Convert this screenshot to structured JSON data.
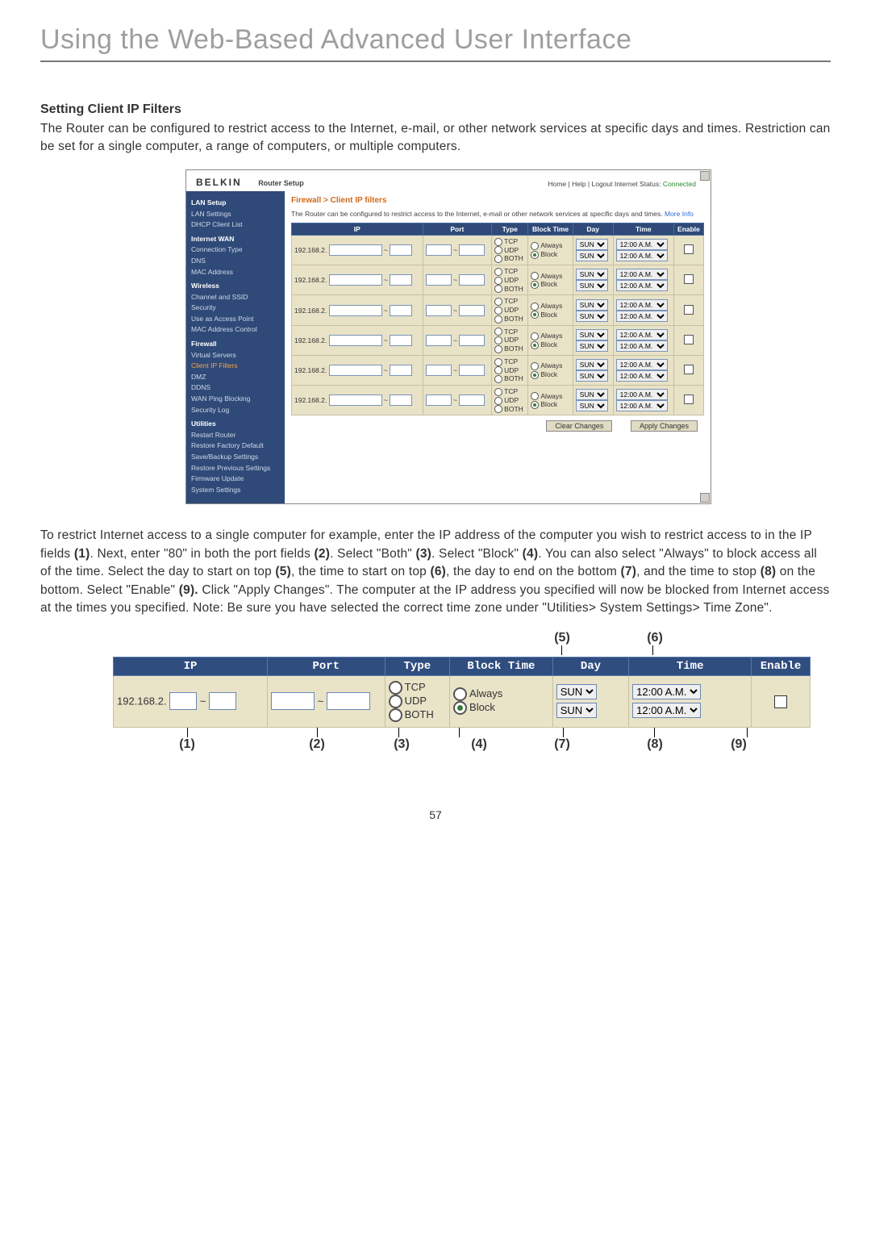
{
  "page": {
    "title": "Using the Web-Based Advanced User Interface",
    "section_heading": "Setting Client IP Filters",
    "intro": "The Router can be configured to restrict access to the Internet, e-mail, or other network services at specific days and times. Restriction can be set for a single computer, a range of computers, or multiple computers.",
    "page_number": "57"
  },
  "router_ui": {
    "brand": "BELKIN",
    "subtitle": "Router Setup",
    "topnav": {
      "links": "Home | Help | Logout   Internet Status:",
      "status_value": "Connected"
    },
    "sidebar": [
      {
        "t": "hdr",
        "label": "LAN Setup"
      },
      {
        "t": "item",
        "label": "LAN Settings"
      },
      {
        "t": "item",
        "label": "DHCP Client List"
      },
      {
        "t": "hdr",
        "label": "Internet WAN"
      },
      {
        "t": "item",
        "label": "Connection Type"
      },
      {
        "t": "item",
        "label": "DNS"
      },
      {
        "t": "item",
        "label": "MAC Address"
      },
      {
        "t": "hdr",
        "label": "Wireless"
      },
      {
        "t": "item",
        "label": "Channel and SSID"
      },
      {
        "t": "item",
        "label": "Security"
      },
      {
        "t": "item",
        "label": "Use as Access Point"
      },
      {
        "t": "item",
        "label": "MAC Address Control"
      },
      {
        "t": "hdr",
        "label": "Firewall"
      },
      {
        "t": "item",
        "label": "Virtual Servers"
      },
      {
        "t": "act",
        "label": "Client IP Filters"
      },
      {
        "t": "item",
        "label": "DMZ"
      },
      {
        "t": "item",
        "label": "DDNS"
      },
      {
        "t": "item",
        "label": "WAN Ping Blocking"
      },
      {
        "t": "item",
        "label": "Security Log"
      },
      {
        "t": "hdr",
        "label": "Utilities"
      },
      {
        "t": "item",
        "label": "Restart Router"
      },
      {
        "t": "item",
        "label": "Restore Factory Default"
      },
      {
        "t": "item",
        "label": "Save/Backup Settings"
      },
      {
        "t": "item",
        "label": "Restore Previous Settings"
      },
      {
        "t": "item",
        "label": "Firmware Update"
      },
      {
        "t": "item",
        "label": "System Settings"
      }
    ],
    "breadcrumb": "Firewall > Client IP filters",
    "note_pre": "The Router can be configured to restrict access to the Internet, e-mail or other network services at specific days and times. ",
    "note_link": "More Info",
    "headers": [
      "IP",
      "Port",
      "Type",
      "Block Time",
      "Day",
      "Time",
      "Enable"
    ],
    "row_defaults": {
      "ip_prefix": "192.168.2.",
      "type_opts": [
        "TCP",
        "UDP",
        "BOTH"
      ],
      "block_opts": [
        "Always",
        "Block"
      ],
      "day": "SUN",
      "time": "12:00 A.M."
    },
    "row_count": 6,
    "buttons": {
      "clear": "Clear Changes",
      "apply": "Apply Changes"
    }
  },
  "instructions": {
    "html": "To restrict Internet access to a single computer for example, enter the IP address of the computer you wish to restrict access to in the IP fields <b>(1)</b>. Next, enter \"80\" in both the port fields <b>(2)</b>. Select \"Both\" <b>(3)</b>. Select \"Block\" <b>(4)</b>. You can also select \"Always\" to block access all of the time. Select the day to start on top <b>(5)</b>, the time to start on top <b>(6)</b>, the day to end on the bottom <b>(7)</b>, and the time to stop <b>(8)</b> on the bottom. Select \"Enable\" <b>(9).</b> Click \"Apply Changes\". The computer at the IP address you specified will now be blocked from Internet access at the times you specified. Note: Be sure you have selected the correct time zone under \"Utilities> System Settings> Time Zone\"."
  },
  "callouts": {
    "top": {
      "c5": "(5)",
      "c6": "(6)"
    },
    "bottom": {
      "c1": "(1)",
      "c2": "(2)",
      "c3": "(3)",
      "c4": "(4)",
      "c7": "(7)",
      "c8": "(8)",
      "c9": "(9)"
    }
  },
  "detail": {
    "headers": [
      "IP",
      "Port",
      "Type",
      "Block Time",
      "Day",
      "Time",
      "Enable"
    ],
    "ip_prefix": "192.168.2.",
    "type": {
      "tcp": "TCP",
      "udp": "UDP",
      "both": "BOTH"
    },
    "block": {
      "always": "Always",
      "block": "Block",
      "selected": "block"
    },
    "day": "SUN",
    "time": "12:00 A.M."
  }
}
